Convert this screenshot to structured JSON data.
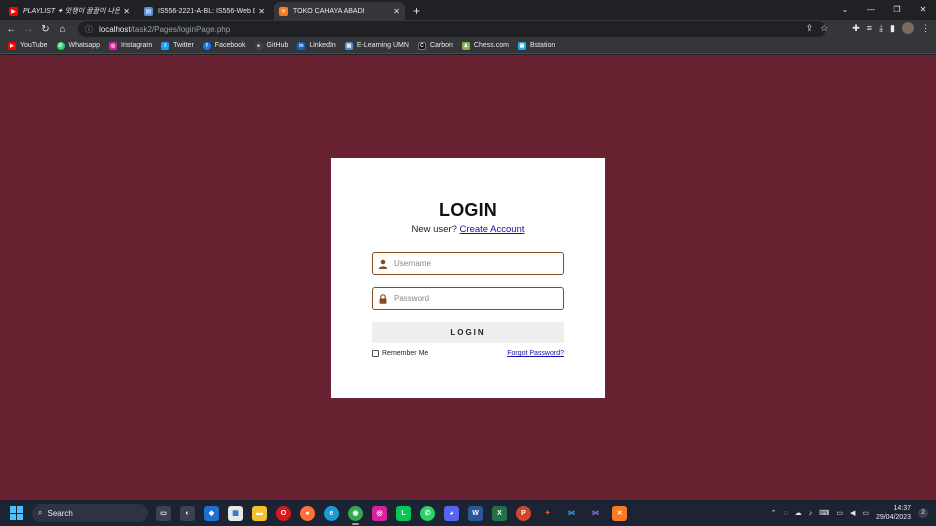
{
  "browser": {
    "tabs": [
      {
        "title": "PLAYLIST ✦ 맛쟁이 끌끌이 나온",
        "bold_prefix": "PLAYLIST",
        "icon": "youtube-icon",
        "color": "#ff0000"
      },
      {
        "title": "IS556-2221-A-BL: IS556-Web Dev",
        "icon": "elearning-icon",
        "color": "#5b8bd0"
      },
      {
        "title": "TOKO CAHAYA ABADI",
        "icon": "xampp-icon",
        "color": "#fb7a24"
      }
    ],
    "new_tab": "+",
    "window_controls": [
      "⌄",
      "—",
      "❐",
      "✕"
    ],
    "url": {
      "host": "localhost",
      "path": "/task2/Pages/loginPage.php"
    },
    "bookmarks": [
      {
        "label": "YouTube",
        "icon": "youtube-icon",
        "color": "#ff0000"
      },
      {
        "label": "Whatsapp",
        "icon": "whatsapp-icon",
        "color": "#25d366"
      },
      {
        "label": "Instagram",
        "icon": "instagram-icon",
        "color": "#d6249f"
      },
      {
        "label": "Twitter",
        "icon": "twitter-icon",
        "color": "#1da1f2"
      },
      {
        "label": "Facebook",
        "icon": "facebook-icon",
        "color": "#1877f2"
      },
      {
        "label": "GitHub",
        "icon": "github-icon",
        "color": "#444444"
      },
      {
        "label": "LinkedIn",
        "icon": "linkedin-icon",
        "color": "#0a66c2"
      },
      {
        "label": "E-Learning UMN",
        "icon": "elearning-icon",
        "color": "#5b8bd0"
      },
      {
        "label": "Carbon",
        "icon": "carbon-icon",
        "color": "#111111"
      },
      {
        "label": "Chess.com",
        "icon": "chess-icon",
        "color": "#81b64c"
      },
      {
        "label": "Bstation",
        "icon": "bstation-icon",
        "color": "#23ade5"
      }
    ]
  },
  "login": {
    "title": "LOGIN",
    "new_user_text": "New user?",
    "create_account_link": "Create Account",
    "username_placeholder": "Username",
    "password_placeholder": "Password",
    "login_button": "LOGIN",
    "remember_me": "Remember Me",
    "forgot_password": "Forgot Password?",
    "accent_color": "#8c4a1c",
    "background_color": "#692232"
  },
  "taskbar": {
    "search_label": "Search",
    "time": "14:37",
    "date": "29/04/2023",
    "notification_count": "2"
  }
}
